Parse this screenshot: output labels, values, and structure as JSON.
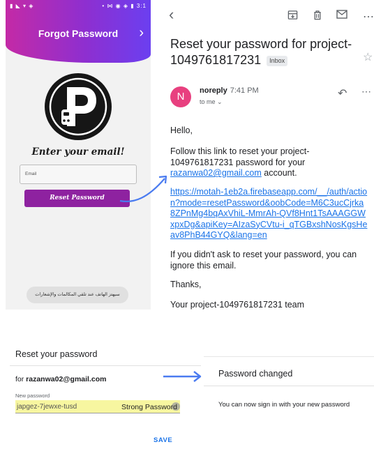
{
  "phone": {
    "status_left": "▮ ◣ ▾ ◈",
    "status_right": "• ⋈ ◉ ◈ ▮ 3:1",
    "header_title": "Forgot Password",
    "header_chevron": "›",
    "logo_letter": "P",
    "enter_email_heading": "Enter your email!",
    "email_placeholder": "Email",
    "reset_button": "Reset Password",
    "toast_text": "سيهتز الهاتف عند تلقي المكالمات والإشعارات"
  },
  "gmail": {
    "toolbar": {
      "back_icon": "‹",
      "archive_icon": "⬇",
      "delete_icon": "🗑",
      "mail_icon": "✉",
      "more_icon": "⋯"
    },
    "subject": "Reset your password for project-1049761817231",
    "inbox_label": "Inbox",
    "star_icon": "☆",
    "sender_initial": "N",
    "sender_name": "noreply",
    "time": "7:41 PM",
    "to_me": "to me ⌄",
    "reply_icon": "↶",
    "more_icon": "⋯",
    "greeting": "Hello,",
    "line_before_email": "Follow this link to reset your project-1049761817231 password for your",
    "recipient_email": "razanwa02@gmail.com",
    "line_after_email": " account.",
    "reset_link": "https://motah-1eb2a.firebaseapp.com/__/auth/action?mode=resetPassword&oobCode=M6C3ucCjrka8ZPnMg4bqAxVhiL-MmrAh-QVf8Hnt1TsAAAGGWxpxDg&apiKey=AIzaSyCVtu-i_qTGBxshNosKgsHeav8PhB44GYQ&lang=en",
    "ignore_text": "If you didn't ask to reset your password, you can ignore this email.",
    "thanks": "Thanks,",
    "signature": "Your project-1049761817231 team"
  },
  "reset_dialog": {
    "title": "Reset your password",
    "for_prefix": "for ",
    "for_email": "razanwa02@gmail.com",
    "new_password_label": "New password",
    "new_password_value": "japgez-7jewxe-tusd",
    "strength_label": "Strong Password",
    "save_button": "SAVE"
  },
  "password_changed": {
    "title": "Password changed",
    "message": "You can now sign in with your new password"
  },
  "colors": {
    "header_gradient_start": "#c42aa6",
    "header_gradient_end": "#6b3ff0",
    "reset_button": "#8e22a0",
    "link_blue": "#1a73e8",
    "arrow_blue": "#4a7bf0",
    "avatar_pink": "#e8407f",
    "password_highlight": "#f7f6a0"
  }
}
